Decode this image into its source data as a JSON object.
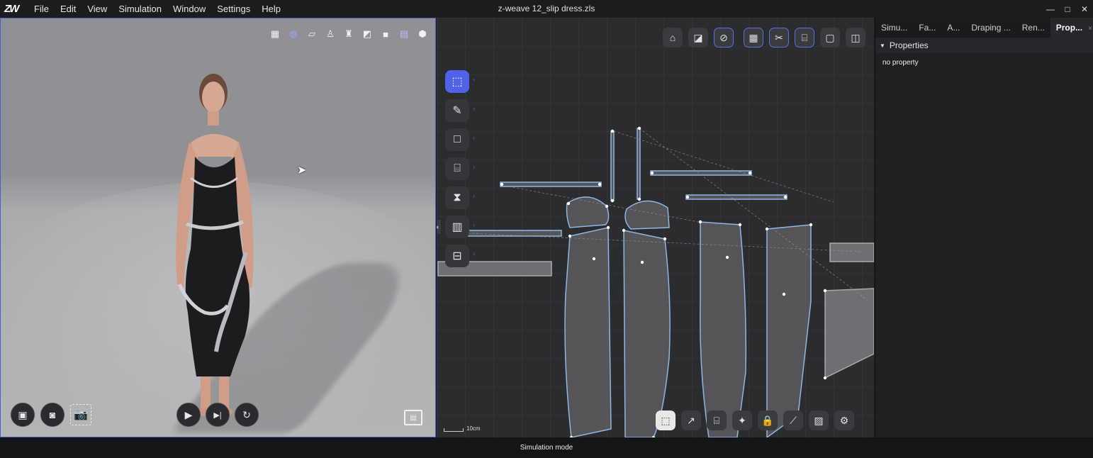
{
  "app": {
    "logo": "ZW",
    "document_title": "z-weave 12_slip dress.zls"
  },
  "menu": [
    "File",
    "Edit",
    "View",
    "Simulation",
    "Window",
    "Settings",
    "Help"
  ],
  "window_controls": {
    "minimize": "—",
    "maximize": "□",
    "close": "✕"
  },
  "viewport3d": {
    "top_icons": [
      "wireframe-icon",
      "fabric-ball-icon",
      "surface-icon",
      "avatar-icon",
      "garment-icon",
      "lighting-icon",
      "cube-icon",
      "texture-icon",
      "box-icon"
    ],
    "bottom_left": {
      "record_label": "▣",
      "snapshot_label": "◙",
      "camera_label": "📷"
    },
    "play": {
      "play": "▶",
      "step": "▶|",
      "reset": "↻"
    },
    "film_label": "▤"
  },
  "viewport2d": {
    "left_tools": [
      "select-tool-icon",
      "pen-tool-icon",
      "rectangle-tool-icon",
      "sewing-tool-icon",
      "zipper-tool-icon",
      "map-tool-icon",
      "measure-tool-icon"
    ],
    "top_tools": [
      "front-view-icon",
      "layout-icon",
      "pin-icon",
      "grid-icon",
      "cut-icon",
      "sew-icon",
      "display-icon",
      "arrange-icon"
    ],
    "bottom_tools": [
      "select-pattern-icon",
      "curve-edit-icon",
      "sewing-edit-icon",
      "pin-edit-icon",
      "lock-icon",
      "line-edit-icon",
      "image-icon",
      "settings-icon"
    ],
    "scale_label": "10cm"
  },
  "right_panel": {
    "tabs": [
      {
        "label": "Simu...",
        "active": false
      },
      {
        "label": "Fa...",
        "active": false
      },
      {
        "label": "A...",
        "active": false
      },
      {
        "label": "Draping ...",
        "active": false
      },
      {
        "label": "Ren...",
        "active": false
      },
      {
        "label": "Prop...",
        "active": true
      }
    ],
    "close_glyph": "×",
    "more_glyph": "▼",
    "section_title": "Properties",
    "empty_text": "no property"
  },
  "status": {
    "mode": "Simulation mode"
  }
}
